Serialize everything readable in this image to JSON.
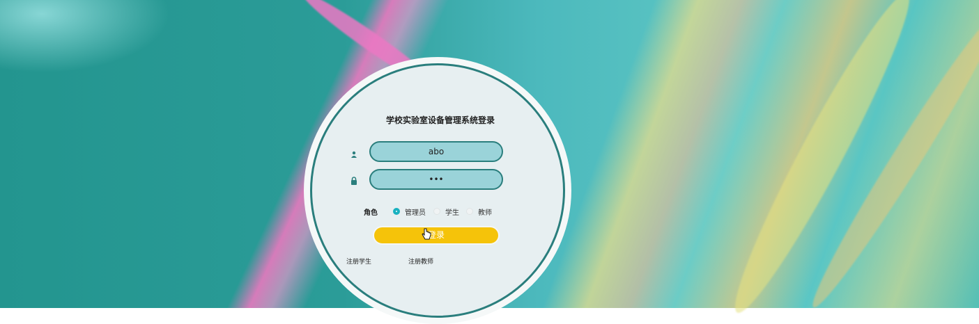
{
  "login": {
    "title": "学校实验室设备管理系统登录",
    "username_value": "abo",
    "password_value": "•••",
    "role_label": "角色",
    "roles": [
      {
        "label": "管理员",
        "selected": true
      },
      {
        "label": "学生",
        "selected": false
      },
      {
        "label": "教师",
        "selected": false
      }
    ],
    "login_button": "登录",
    "register_student": "注册学生",
    "register_teacher": "注册教师"
  },
  "icons": [
    "user-icon",
    "lock-icon",
    "hand-cursor-icon"
  ],
  "colors": {
    "accent": "#2a7e7d",
    "field_bg": "#9ad3d9",
    "button": "#f5c30a",
    "radio_checked": "#18b1c0"
  }
}
